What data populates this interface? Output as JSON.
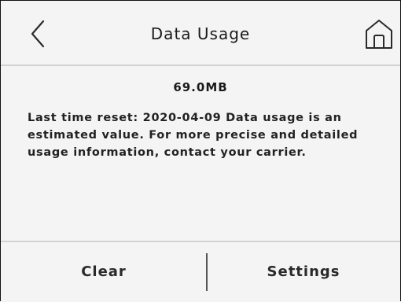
{
  "header": {
    "title": "Data Usage",
    "back_icon": "chevron-left-icon",
    "home_icon": "home-icon"
  },
  "content": {
    "usage_value": "69.0MB",
    "description": "Last time reset: 2020-04-09  Data usage is an estimated value.  For more precise and detailed usage information, contact your carrier."
  },
  "footer": {
    "clear_label": "Clear",
    "settings_label": "Settings"
  },
  "colors": {
    "background": "#f4f4f4",
    "text": "#1a1a1a",
    "divider": "#d2d2d2"
  }
}
